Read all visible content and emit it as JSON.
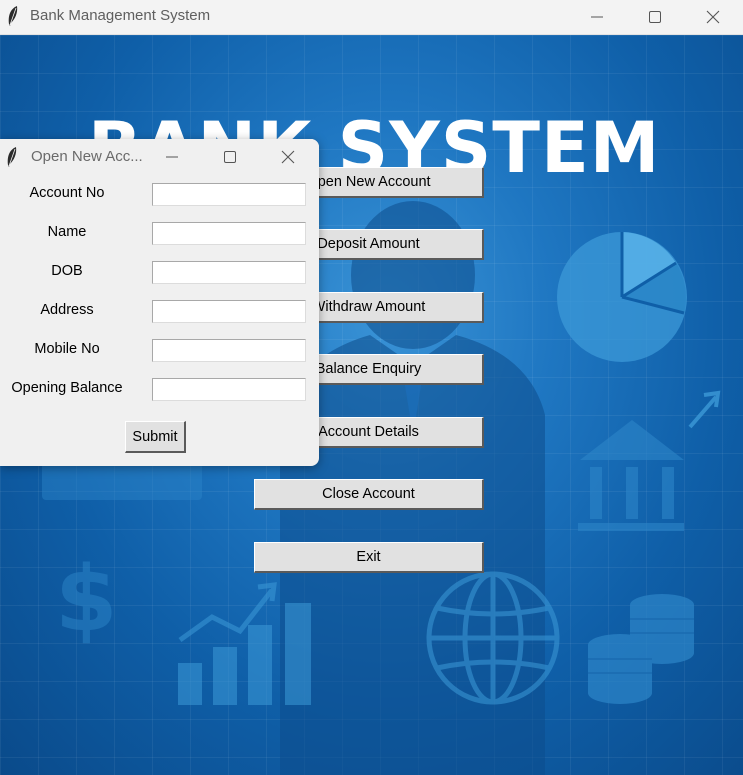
{
  "main_window": {
    "title": "Bank Management System",
    "headline": "BANK SYSTEM",
    "menu": [
      {
        "name": "open-new-account-button",
        "label": "Open New Account"
      },
      {
        "name": "deposit-amount-button",
        "label": "Deposit Amount"
      },
      {
        "name": "withdraw-amount-button",
        "label": "Withdraw Amount"
      },
      {
        "name": "balance-enquiry-button",
        "label": "Balance Enquiry"
      },
      {
        "name": "account-details-button",
        "label": "Account Details"
      },
      {
        "name": "close-account-button",
        "label": "Close Account"
      },
      {
        "name": "exit-button",
        "label": "Exit"
      }
    ]
  },
  "dialog": {
    "title": "Open New Acc...",
    "fields": [
      {
        "label": "Account No",
        "value": ""
      },
      {
        "label": "Name",
        "value": ""
      },
      {
        "label": "DOB",
        "value": ""
      },
      {
        "label": "Address",
        "value": ""
      },
      {
        "label": "Mobile No",
        "value": ""
      },
      {
        "label": "Opening Balance",
        "value": ""
      }
    ],
    "submit_label": "Submit"
  },
  "icons": {
    "app": "feather-icon",
    "minimize": "minimize-icon",
    "maximize": "maximize-icon",
    "close": "close-icon"
  }
}
